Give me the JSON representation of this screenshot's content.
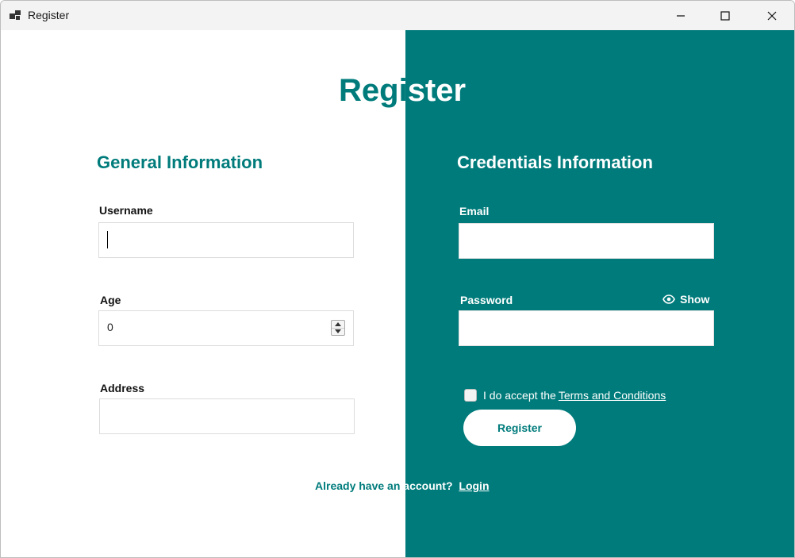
{
  "window": {
    "title": "Register",
    "controls": [
      "minimize-icon",
      "maximize-icon",
      "close-icon"
    ]
  },
  "colors": {
    "accent": "#007b7b",
    "background": "#ffffff",
    "panel_text": "#ffffff"
  },
  "heading": {
    "left_part": "Regi",
    "right_part": "ster"
  },
  "general": {
    "title": "General Information",
    "username_label": "Username",
    "username_value": "",
    "age_label": "Age",
    "age_value": "0",
    "address_label": "Address",
    "address_value": ""
  },
  "credentials": {
    "title": "Credentials Information",
    "email_label": "Email",
    "email_value": "",
    "password_label": "Password",
    "password_value": "",
    "show_label": "Show",
    "show_icon": "eye-icon",
    "terms_prefix": "I do accept the",
    "terms_link": "Terms and Conditions",
    "terms_checked": false,
    "register_button": "Register"
  },
  "footer": {
    "prefix_left": "Already have an ",
    "prefix_right": "account?",
    "login_link": "Login"
  }
}
